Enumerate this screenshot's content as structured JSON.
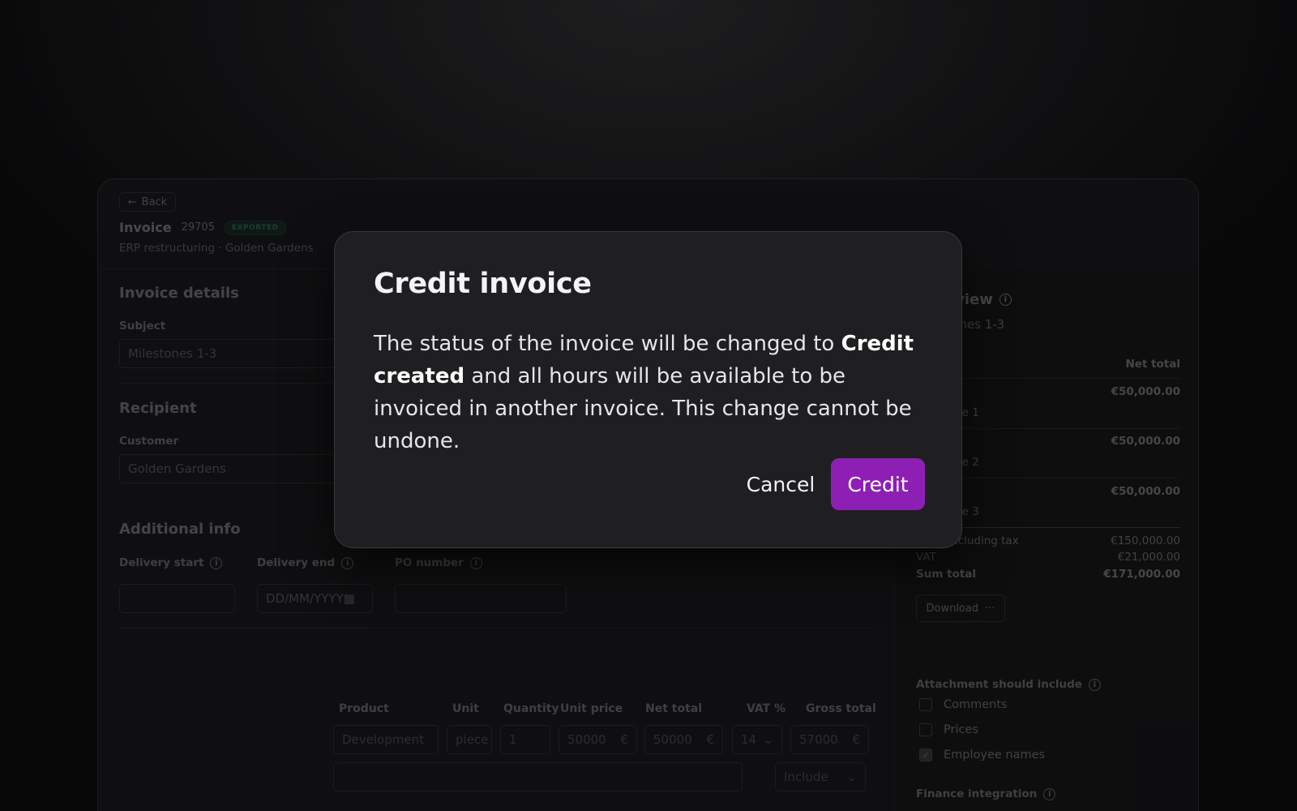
{
  "header": {
    "back_label": "Back",
    "invoice_label": "Invoice",
    "invoice_number": "29705",
    "status_badge": "EXPORTED",
    "subtitle": "ERP restructuring · Golden Gardens"
  },
  "details": {
    "section_title": "Invoice details",
    "subject_label": "Subject",
    "subject_value": "Milestones 1-3",
    "recipient_title": "Recipient",
    "customer_label": "Customer",
    "customer_value": "Golden Gardens",
    "additional_title": "Additional info",
    "delivery_start_label": "Delivery start",
    "delivery_end_label": "Delivery end",
    "delivery_end_placeholder": "DD/MM/YYYY",
    "po_number_label": "PO number"
  },
  "table": {
    "headers": [
      "Product",
      "Unit",
      "Quantity",
      "Unit price",
      "Net total",
      "VAT %",
      "Gross total"
    ],
    "row": {
      "product": "Development",
      "unit": "piece",
      "quantity": "1",
      "unit_price": "50000",
      "net_total": "50000",
      "vat": "14",
      "gross_total": "57000",
      "currency": "€",
      "include": "Include"
    }
  },
  "overview": {
    "title": "Overview",
    "subtitle": "Milestones 1-3",
    "net_total_header": "Net total",
    "items": [
      {
        "amount": "€50,000.00",
        "label": "Milestone 1"
      },
      {
        "amount": "€50,000.00",
        "label": "Milestone 2"
      },
      {
        "amount": "€50,000.00",
        "label": "Milestone 3"
      }
    ],
    "total_excl_label": "Total excluding tax",
    "total_excl_value": "€150,000.00",
    "vat_label": "VAT",
    "vat_value": "€21,000.00",
    "sum_label": "Sum total",
    "sum_value": "€171,000.00",
    "download_label": "Download",
    "attachment_title": "Attachment should include",
    "attachment_options": [
      {
        "label": "Comments",
        "checked": false
      },
      {
        "label": "Prices",
        "checked": false
      },
      {
        "label": "Employee names",
        "checked": true
      }
    ],
    "finance_title": "Finance integration"
  },
  "modal": {
    "title": "Credit invoice",
    "body_prefix": "The status of the invoice will be changed to ",
    "body_bold": "Credit created",
    "body_suffix": " and all hours will be available to be invoiced in another invoice. This change cannot be undone.",
    "cancel_label": "Cancel",
    "confirm_label": "Credit",
    "confirm_color": "#8e1fb5"
  }
}
